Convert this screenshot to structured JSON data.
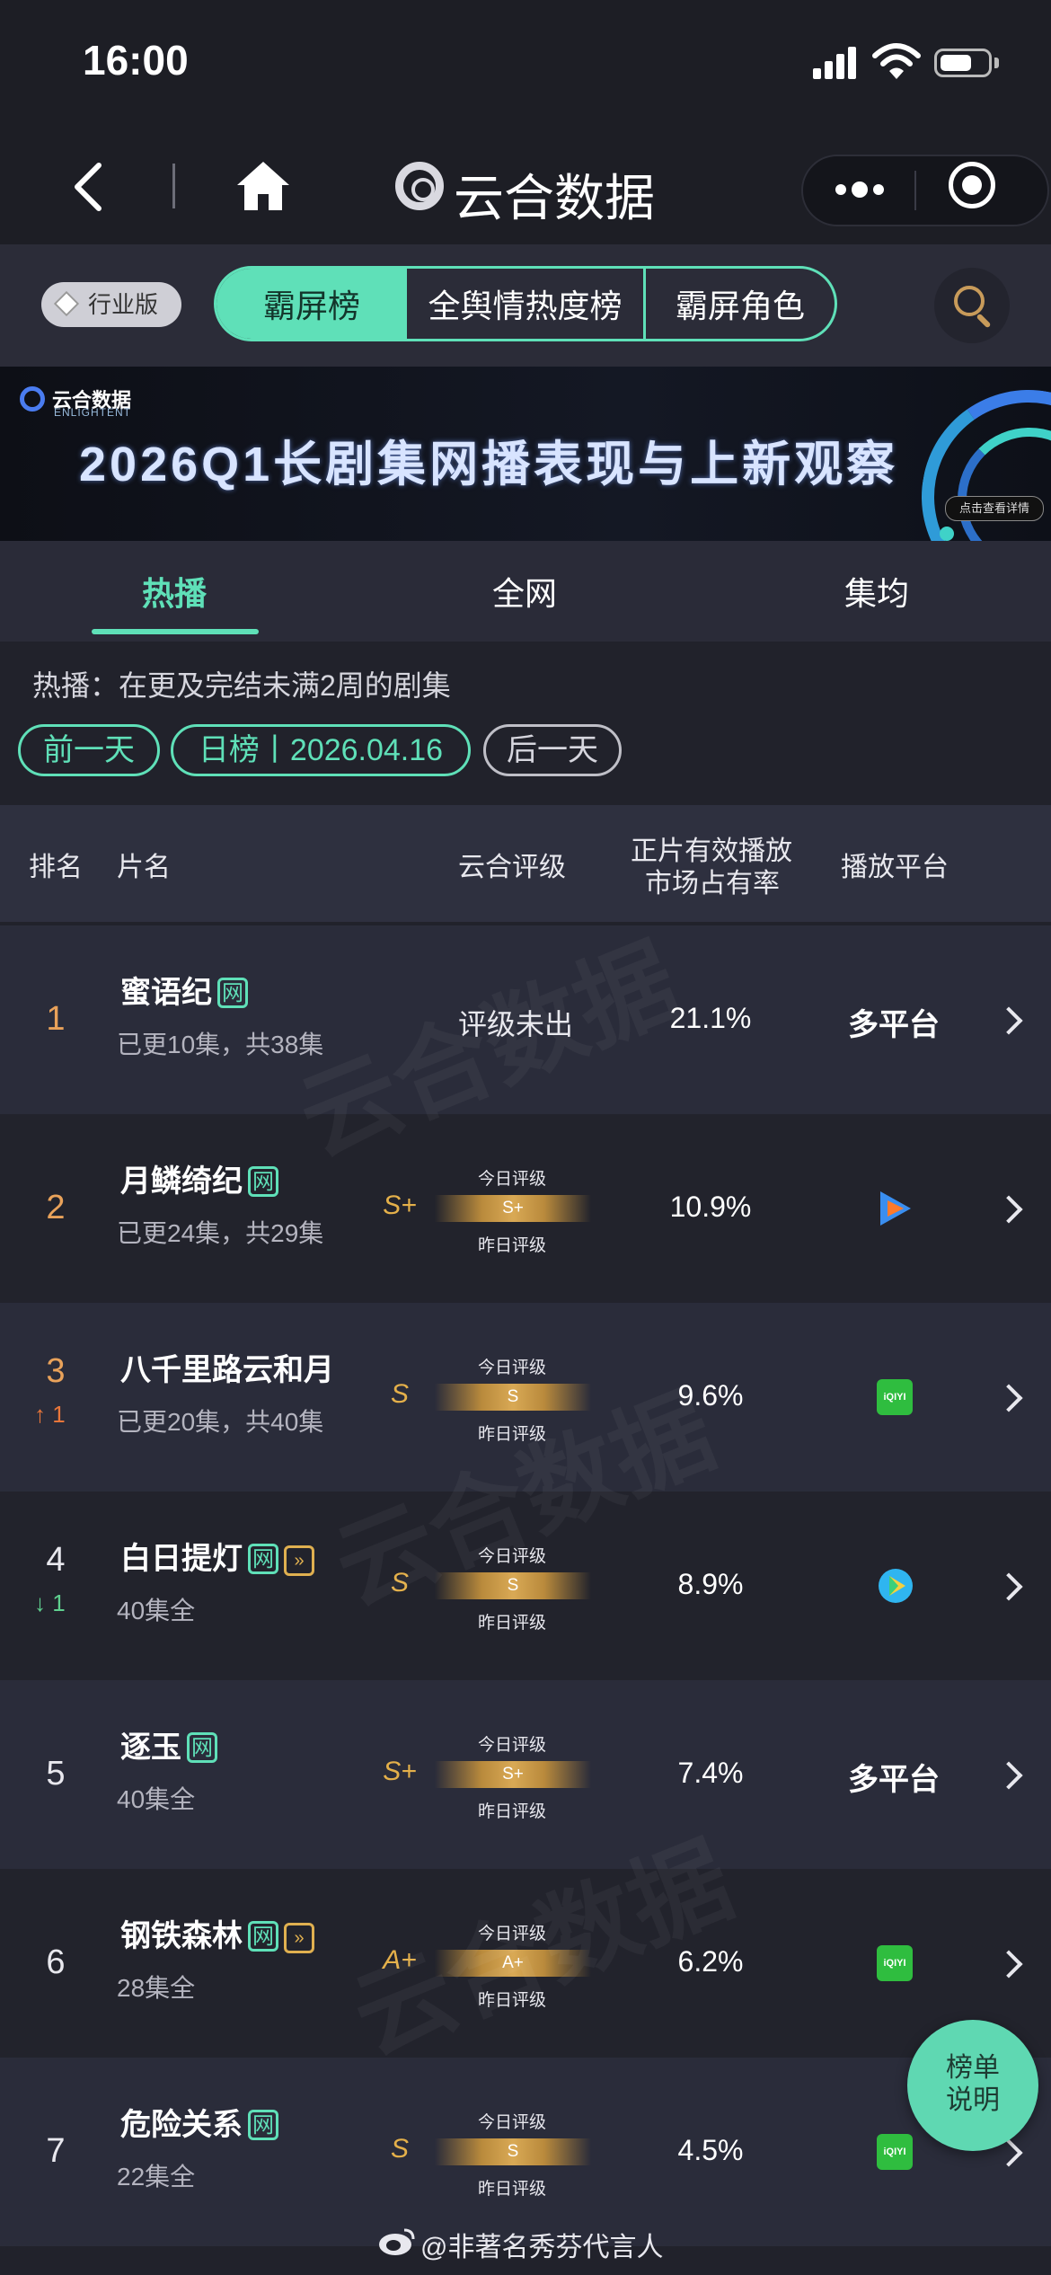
{
  "status_bar": {
    "time": "16:00",
    "battery_level": 0.65
  },
  "nav": {
    "app_title": "云合数据"
  },
  "filters": {
    "edition": "行业版",
    "segments": [
      "霸屏榜",
      "全舆情热度榜",
      "霸屏角色"
    ],
    "active_segment": "霸屏榜"
  },
  "banner": {
    "brand": "云合数据",
    "brand_en": "ENLIGHTENT",
    "title": "2026Q1长剧集网播表现与上新观察",
    "button": "点击查看详情"
  },
  "tabs": [
    {
      "label": "热播",
      "active": true
    },
    {
      "label": "全网",
      "active": false
    },
    {
      "label": "集均",
      "active": false
    }
  ],
  "description": "热播：在更及完结未满2周的剧集",
  "date_nav": {
    "prev": "前一天",
    "current": "日榜丨2026.04.16",
    "next": "后一天"
  },
  "table": {
    "headers": {
      "rank": "排名",
      "title": "片名",
      "rating": "云合评级",
      "share_line1": "正片有效播放",
      "share_line2": "市场占有率",
      "platform": "播放平台"
    },
    "today_label": "今日评级",
    "yesterday_label": "昨日评级",
    "rows": [
      {
        "rank": "1",
        "title": "蜜语纪",
        "tags": [
          "网"
        ],
        "episodes": "已更10集，共38集",
        "rating_text": "评级未出",
        "share": "21.1%",
        "platform_text": "多平台"
      },
      {
        "rank": "2",
        "title": "月鳞绮纪",
        "tags": [
          "网"
        ],
        "episodes": "已更24集，共29集",
        "grade_left": "S+",
        "grade_today": "S+",
        "share": "10.9%",
        "platform_icon": "tencent-video-icon"
      },
      {
        "rank": "3",
        "rank_change": "1",
        "rank_dir": "up",
        "title": "八千里路云和月",
        "tags": [],
        "episodes": "已更20集，共40集",
        "grade_left": "S",
        "grade_today": "S",
        "share": "9.6%",
        "platform_icon": "iqiyi-icon",
        "platform_icon_text": "iQIYI"
      },
      {
        "rank": "4",
        "rank_change": "1",
        "rank_dir": "down",
        "title": "白日提灯",
        "tags": [
          "网",
          "play"
        ],
        "episodes": "40集全",
        "grade_left": "S",
        "grade_today": "S",
        "share": "8.9%",
        "platform_icon": "youku-icon"
      },
      {
        "rank": "5",
        "title": "逐玉",
        "tags": [
          "网"
        ],
        "episodes": "40集全",
        "grade_left": "S+",
        "grade_today": "S+",
        "share": "7.4%",
        "platform_text": "多平台"
      },
      {
        "rank": "6",
        "title": "钢铁森林",
        "tags": [
          "网",
          "play"
        ],
        "episodes": "28集全",
        "grade_left": "A+",
        "grade_today": "A+",
        "share": "6.2%",
        "platform_icon": "iqiyi-icon",
        "platform_icon_text": "iQIYI"
      },
      {
        "rank": "7",
        "title": "危险关系",
        "tags": [
          "网"
        ],
        "episodes": "22集全",
        "grade_left": "S",
        "grade_today": "S",
        "share": "4.5%",
        "platform_icon": "iqiyi-icon",
        "platform_icon_text": "iQIYI"
      }
    ]
  },
  "help_button": {
    "line1": "榜单",
    "line2": "说明"
  },
  "watermark": {
    "text": "@非著名秀芬代言人"
  },
  "colors": {
    "accent": "#5fe0b8",
    "gold": "#e4b04a",
    "rank_top": "#e9a25a",
    "up": "#e8763a",
    "down": "#5fd08f",
    "background": "#21222b"
  }
}
